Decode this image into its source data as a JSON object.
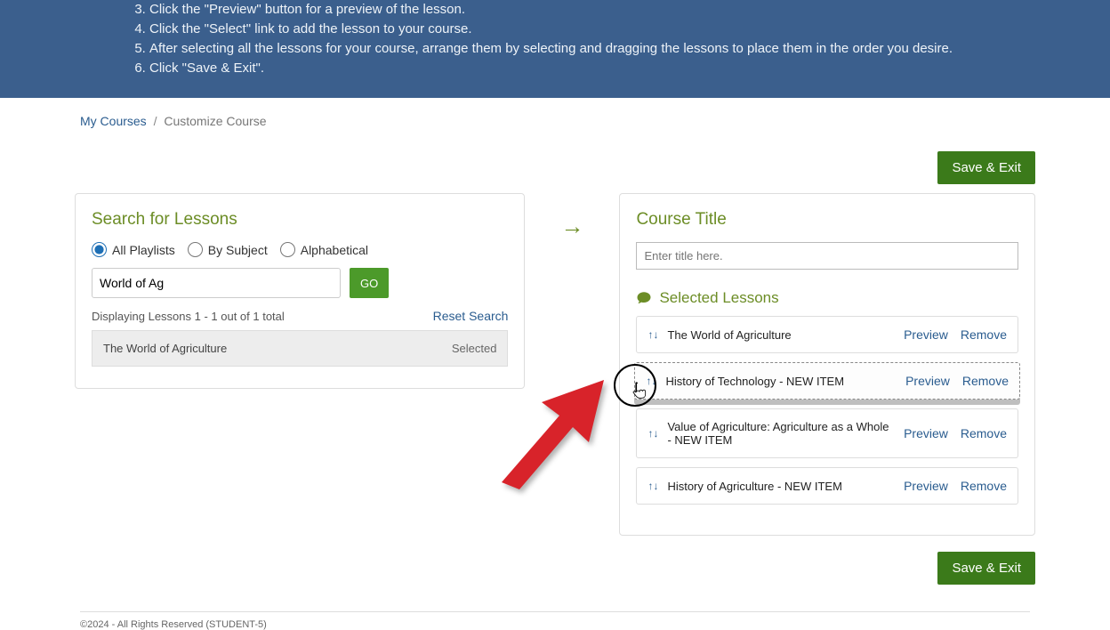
{
  "instructions": {
    "start": 3,
    "items": [
      "Click the \"Preview\" button for a preview of the lesson.",
      "Click the \"Select\" link to add the lesson to your course.",
      "After selecting all the lessons for your course, arrange them by selecting and dragging the lessons to place them in the order you desire.",
      "Click \"Save & Exit\"."
    ]
  },
  "breadcrumb": {
    "home": "My Courses",
    "current": "Customize Course"
  },
  "save_label": "Save & Exit",
  "search": {
    "title": "Search for Lessons",
    "filters": {
      "all": "All Playlists",
      "by_subject": "By Subject",
      "alpha": "Alphabetical"
    },
    "input_value": "World of Ag",
    "go_label": "GO",
    "result_meta": "Displaying Lessons 1 - 1 out of 1 total",
    "reset_label": "Reset Search",
    "results": [
      {
        "title": "The World of Agriculture",
        "status": "Selected"
      }
    ]
  },
  "course": {
    "title_label": "Course Title",
    "title_placeholder": "Enter title here.",
    "selected_label": "Selected Lessons",
    "preview_label": "Preview",
    "remove_label": "Remove",
    "lessons": [
      {
        "title": "The World of Agriculture"
      },
      {
        "title": "History of Technology - NEW ITEM",
        "dragging": true
      },
      {
        "title": "Value of Agriculture: Agriculture as a Whole - NEW ITEM"
      },
      {
        "title": "History of Agriculture - NEW ITEM"
      }
    ]
  },
  "footer": "©2024 - All Rights Reserved  (STUDENT-5)"
}
